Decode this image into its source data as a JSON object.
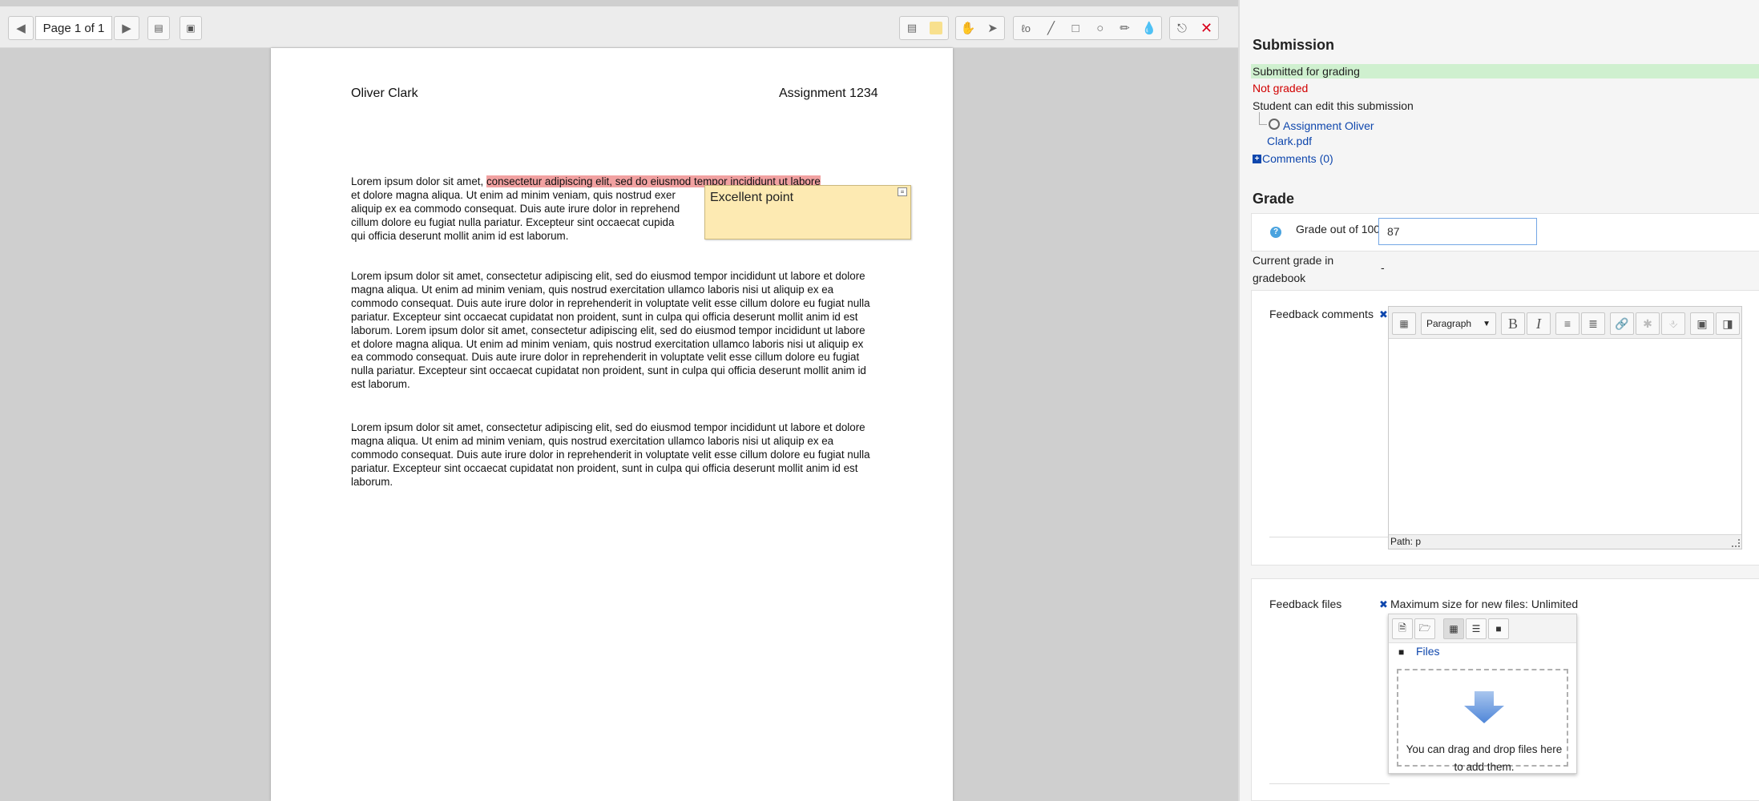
{
  "editor": {
    "toolbar": {
      "page_label": "Page 1 of 1",
      "prev_icon": "triangle-left-icon",
      "next_icon": "triangle-right-icon"
    },
    "document": {
      "author": "Oliver Clark",
      "assignment": "Assignment 1234",
      "para1_before": "Lorem ipsum dolor sit amet, ",
      "para1_highlight": "consectetur adipiscing elit, sed do eiusmod tempor incididunt ut labore",
      "para1_line2": "et dolore magna aliqua. Ut enim ad minim veniam, quis nostrud exer",
      "para1_line3": "aliquip ex ea commodo consequat. Duis aute irure dolor in reprehend",
      "para1_line4": "cillum dolore eu fugiat nulla pariatur. Excepteur sint occaecat cupida",
      "para1_line5": "qui officia deserunt mollit anim id est laborum.",
      "para2": "Lorem ipsum dolor sit amet, consectetur adipiscing elit, sed do eiusmod tempor incididunt ut labore et dolore magna aliqua. Ut enim ad minim veniam, quis nostrud exercitation ullamco laboris nisi ut aliquip ex ea commodo consequat. Duis aute irure dolor in reprehenderit in voluptate velit esse cillum dolore eu fugiat nulla pariatur. Excepteur sint occaecat cupidatat non proident, sunt in culpa qui officia deserunt mollit anim id est laborum. Lorem ipsum dolor sit amet, consectetur adipiscing elit, sed do eiusmod tempor incididunt ut labore et dolore magna aliqua. Ut enim ad minim veniam, quis nostrud exercitation ullamco laboris nisi ut aliquip ex ea commodo consequat. Duis aute irure dolor in reprehenderit in voluptate velit esse cillum dolore eu fugiat nulla pariatur. Excepteur sint occaecat cupidatat non proident, sunt in culpa qui officia deserunt mollit anim id est laborum.",
      "para3": "Lorem ipsum dolor sit amet, consectetur adipiscing elit, sed do eiusmod tempor incididunt ut labore et dolore magna aliqua. Ut enim ad minim veniam, quis nostrud exercitation ullamco laboris nisi ut aliquip ex ea commodo consequat. Duis aute irure dolor in reprehenderit in voluptate velit esse cillum dolore eu fugiat nulla pariatur. Excepteur sint occaecat cupidatat non proident, sunt in culpa qui officia deserunt mollit anim id est laborum.",
      "comment": "Excellent point"
    },
    "colors": {
      "highlight": "#f1a1a1",
      "sticky_note": "#fdeab2",
      "delete_icon": "#d9001b",
      "drop_color": "#e0001b"
    }
  },
  "panel": {
    "submission_heading": "Submission",
    "status": "Submitted for grading",
    "grading_status": "Not graded",
    "edit_status": "Student can edit this submission",
    "file_link_line1": "Assignment Oliver",
    "file_link_line2": "Clark.pdf",
    "comments_link": "Comments (0)",
    "grade_heading": "Grade",
    "grade_label": "Grade out of 100",
    "grade_value": "87",
    "current_grade_label_1": "Current grade in",
    "current_grade_label_2": "gradebook",
    "current_grade_value": "-",
    "feedback_comments_label": "Feedback comments",
    "editor": {
      "format": "Paragraph",
      "bold": "B",
      "italic": "I",
      "path": "Path: p"
    },
    "feedback_files_label": "Feedback files",
    "max_size": "Maximum size for new files: Unlimited",
    "files_folder": "Files",
    "drop_text_1": "You can drag and drop files here",
    "drop_text_2": "to add them."
  }
}
